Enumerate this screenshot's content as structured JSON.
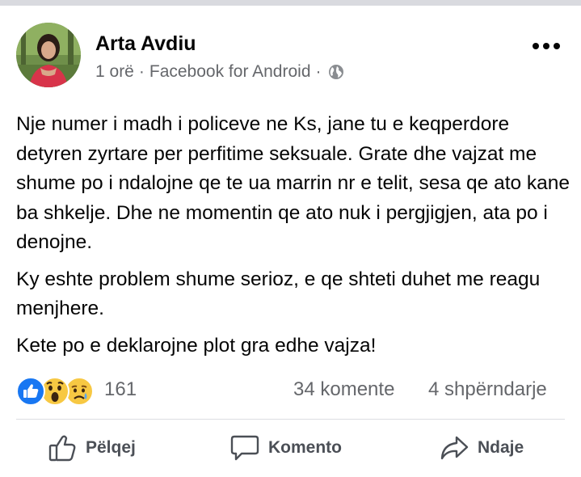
{
  "post": {
    "author": "Arta Avdiu",
    "time": "1 orë",
    "source": "Facebook for Android",
    "separator": "·",
    "paragraphs": [
      "Nje numer i madh i policeve ne Ks, jane tu e keqperdore detyren zyrtare per perfitime seksuale. Grate dhe vajzat me shume po i ndalojne qe te ua marrin nr e telit, sesa qe ato kane ba shkelje. Dhe ne momentin qe ato nuk i pergjigjen, ata po i denojne.",
      "Ky eshte problem shume serioz, e qe shteti duhet me reagu menjhere.",
      "Kete po e deklarojne plot gra edhe vajza!"
    ],
    "privacy_icon": "globe-icon"
  },
  "reactions": {
    "icons": [
      "like-icon",
      "wow-icon",
      "sad-icon"
    ],
    "count": "161",
    "comments": "34 komente",
    "shares": "4 shpërndarje"
  },
  "actions": {
    "like": "Pëlqej",
    "comment": "Komento",
    "share": "Ndaje"
  },
  "colors": {
    "like_blue": "#1877f2",
    "emoji_yellow": "#f7c843",
    "secondary_text": "#65676b"
  }
}
